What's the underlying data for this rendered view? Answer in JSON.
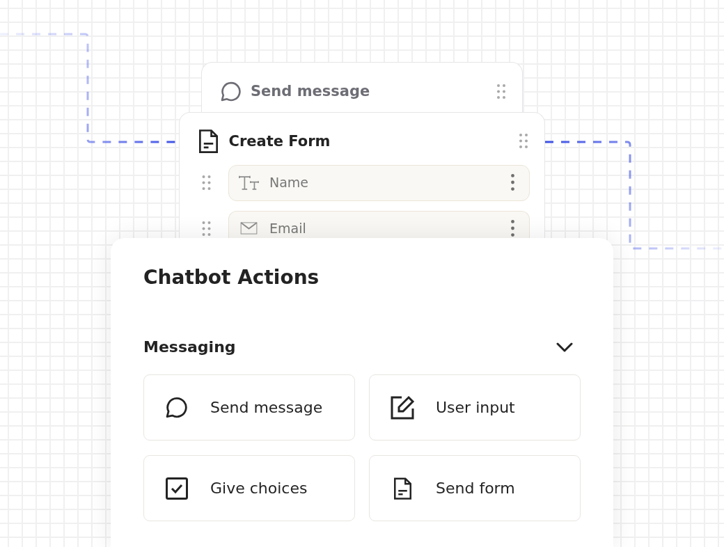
{
  "canvas": {
    "nodes": [
      {
        "kind": "message",
        "title": "Send message"
      },
      {
        "kind": "form",
        "title": "Create Form",
        "fields": [
          {
            "kind": "text",
            "label": "Name"
          },
          {
            "kind": "email",
            "label": "Email"
          }
        ]
      }
    ]
  },
  "panel": {
    "title": "Chatbot Actions",
    "sections": [
      {
        "title": "Messaging",
        "expanded": true,
        "actions": [
          {
            "kind": "message",
            "label": "Send message"
          },
          {
            "kind": "input",
            "label": "User input"
          },
          {
            "kind": "choices",
            "label": "Give choices"
          },
          {
            "kind": "form",
            "label": "Send form"
          }
        ]
      }
    ]
  }
}
